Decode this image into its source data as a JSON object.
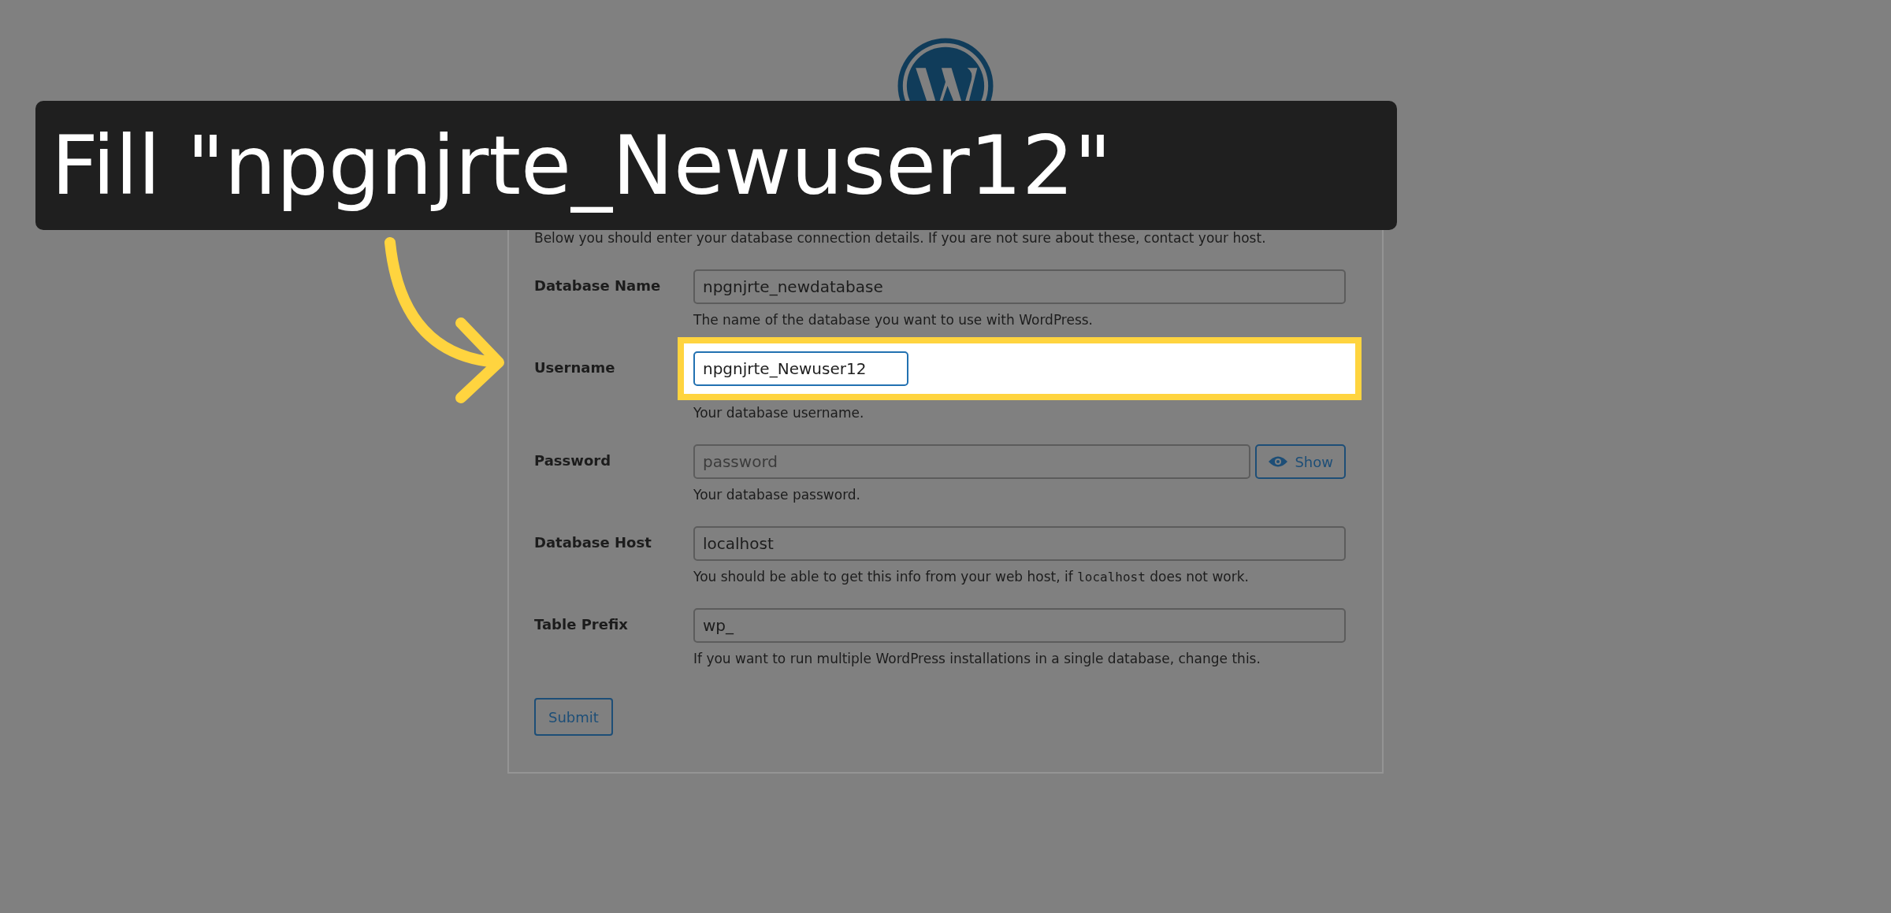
{
  "caption": {
    "text": "Fill \"npgnjrte_Newuser12\""
  },
  "intro": "Below you should enter your database connection details. If you are not sure about these, contact your host.",
  "fields": [
    {
      "label": "Database Name",
      "value": "npgnjrte_newdatabase",
      "help": "The name of the database you want to use with WordPress.",
      "highlighted": false
    },
    {
      "label": "Username",
      "value": "npgnjrte_Newuser12",
      "help": "Your database username.",
      "highlighted": true
    },
    {
      "label": "Password",
      "placeholder": "password",
      "button": "Show",
      "help": "Your database password.",
      "highlighted": false
    },
    {
      "label": "Database Host",
      "value": "localhost",
      "help": "You should be able to get this info from your web host, if ",
      "help_code": "localhost",
      "help_after": " does not work.",
      "highlighted": false
    },
    {
      "label": "Table Prefix",
      "value": "wp_",
      "help": "If you want to run multiple WordPress installations in a single database, change this.",
      "highlighted": false
    }
  ],
  "submit": "Submit"
}
